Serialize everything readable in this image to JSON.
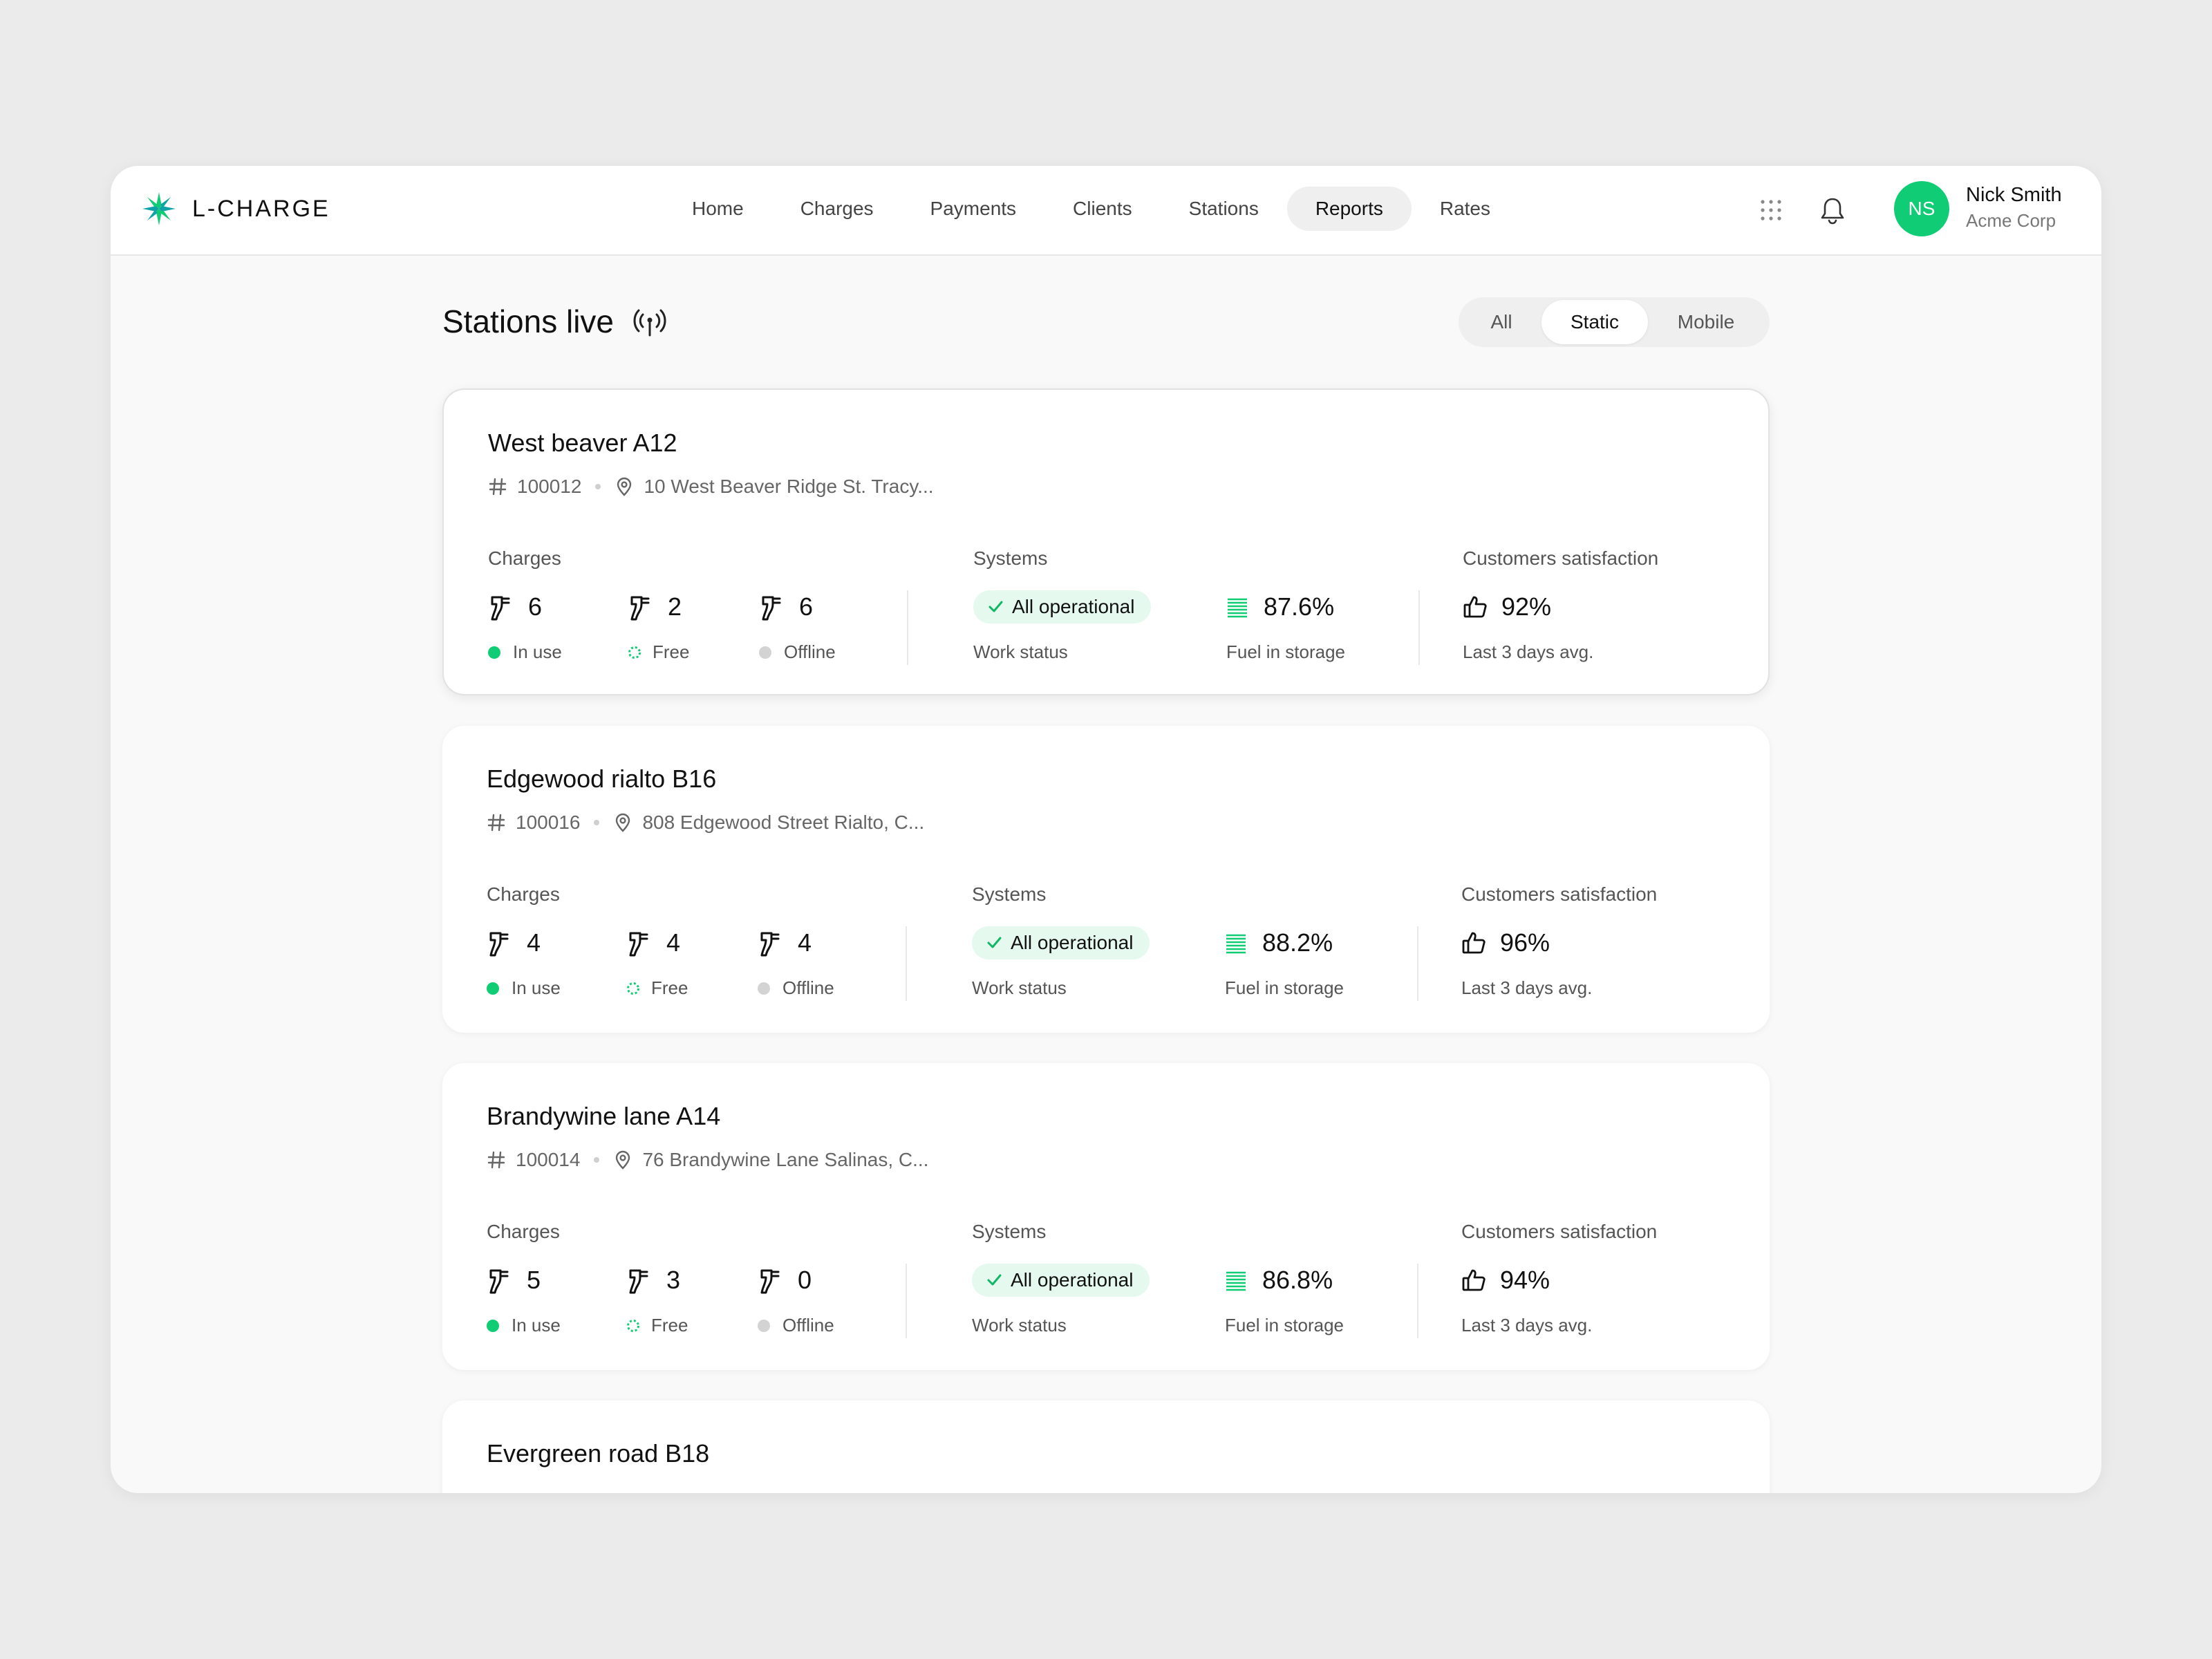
{
  "app": {
    "name": "L-CHARGE"
  },
  "nav": [
    {
      "label": "Home"
    },
    {
      "label": "Charges"
    },
    {
      "label": "Payments"
    },
    {
      "label": "Clients"
    },
    {
      "label": "Stations"
    },
    {
      "label": "Reports"
    },
    {
      "label": "Rates"
    }
  ],
  "nav_active": "Reports",
  "user": {
    "initials": "NS",
    "name": "Nick Smith",
    "org": "Acme Corp"
  },
  "page": {
    "title": "Stations live"
  },
  "filters": [
    {
      "label": "All"
    },
    {
      "label": "Static"
    },
    {
      "label": "Mobile"
    }
  ],
  "filter_active": "Static",
  "labels": {
    "charges": "Charges",
    "systems": "Systems",
    "satisfaction": "Customers satisfaction",
    "in_use": "In use",
    "free": "Free",
    "offline": "Offline",
    "work_status": "Work status",
    "fuel_storage": "Fuel in storage",
    "last_days": "Last 3 days avg."
  },
  "stations": [
    {
      "name": "West beaver A12",
      "id": "100012",
      "address": "10 West Beaver Ridge St. Tracy...",
      "in_use": "6",
      "free": "2",
      "offline": "6",
      "work_status": "All operational",
      "fuel": "87.6%",
      "satisfaction": "92%"
    },
    {
      "name": "Edgewood rialto B16",
      "id": "100016",
      "address": "808 Edgewood Street Rialto, C...",
      "in_use": "4",
      "free": "4",
      "offline": "4",
      "work_status": "All operational",
      "fuel": "88.2%",
      "satisfaction": "96%"
    },
    {
      "name": "Brandywine lane A14",
      "id": "100014",
      "address": "76 Brandywine Lane Salinas, C...",
      "in_use": "5",
      "free": "3",
      "offline": "0",
      "work_status": "All operational",
      "fuel": "86.8%",
      "satisfaction": "94%"
    },
    {
      "name": "Evergreen road B18"
    }
  ],
  "colors": {
    "accent": "#10cc74",
    "badge_bg": "#e6f9ef",
    "offline": "#d3d3d3"
  }
}
